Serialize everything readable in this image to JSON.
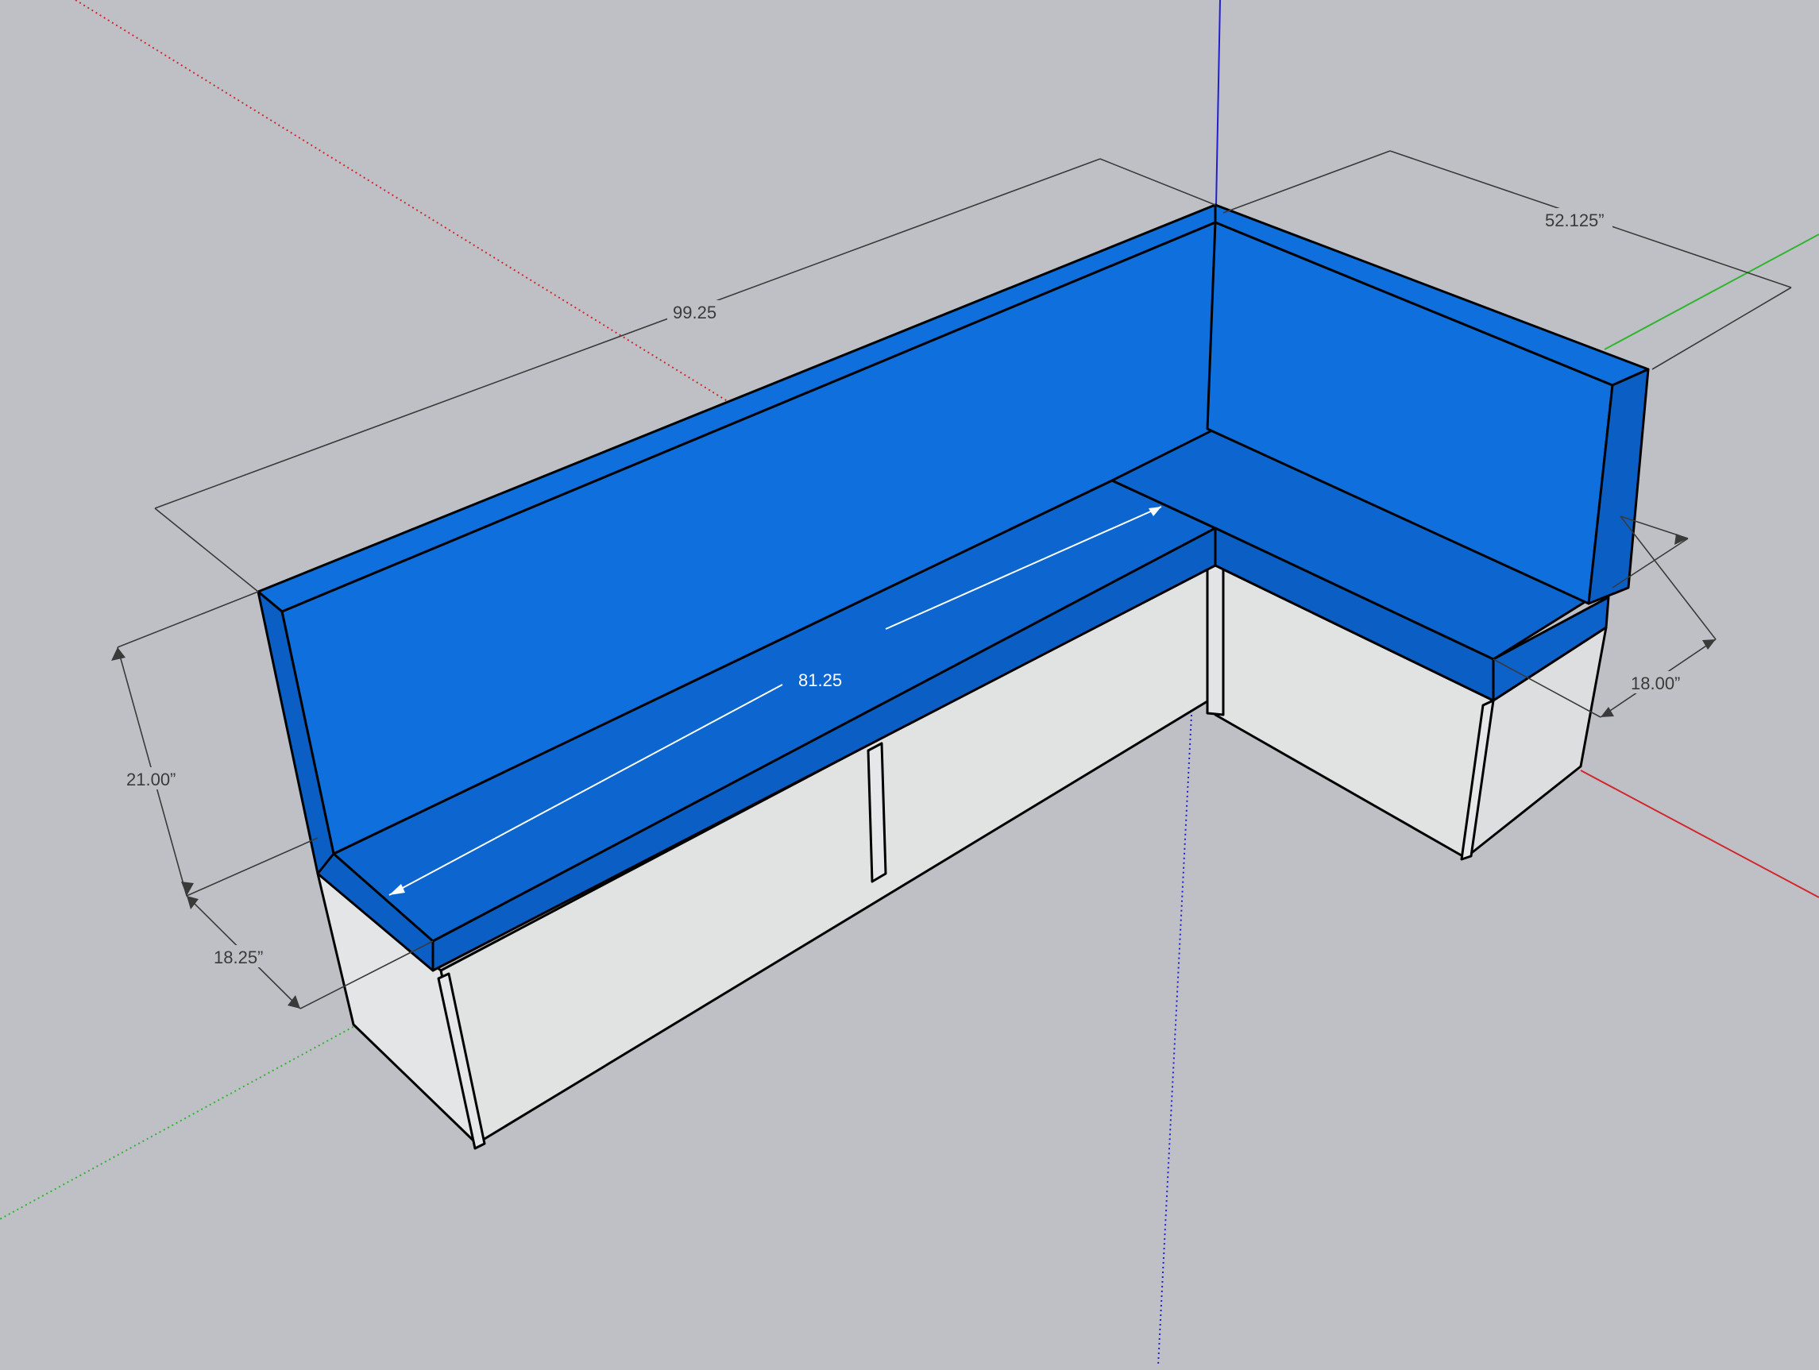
{
  "scene": {
    "background": "#bfc0c5",
    "cushion_color": "#0f6fdc",
    "cushion_shade": "#0d66cf",
    "cushion_dark": "#0b5fc4",
    "box_color": "#e1e2e2",
    "axis_red": "#d0282d",
    "axis_green": "#2fb52f",
    "axis_blue": "#2020d0"
  },
  "dimensions": {
    "overall_length": "99.25",
    "short_length": "52.125”",
    "seat_length": "81.25",
    "back_height": "21.00”",
    "seat_depth_left": "18.25”",
    "seat_depth_right": "18.00”"
  }
}
